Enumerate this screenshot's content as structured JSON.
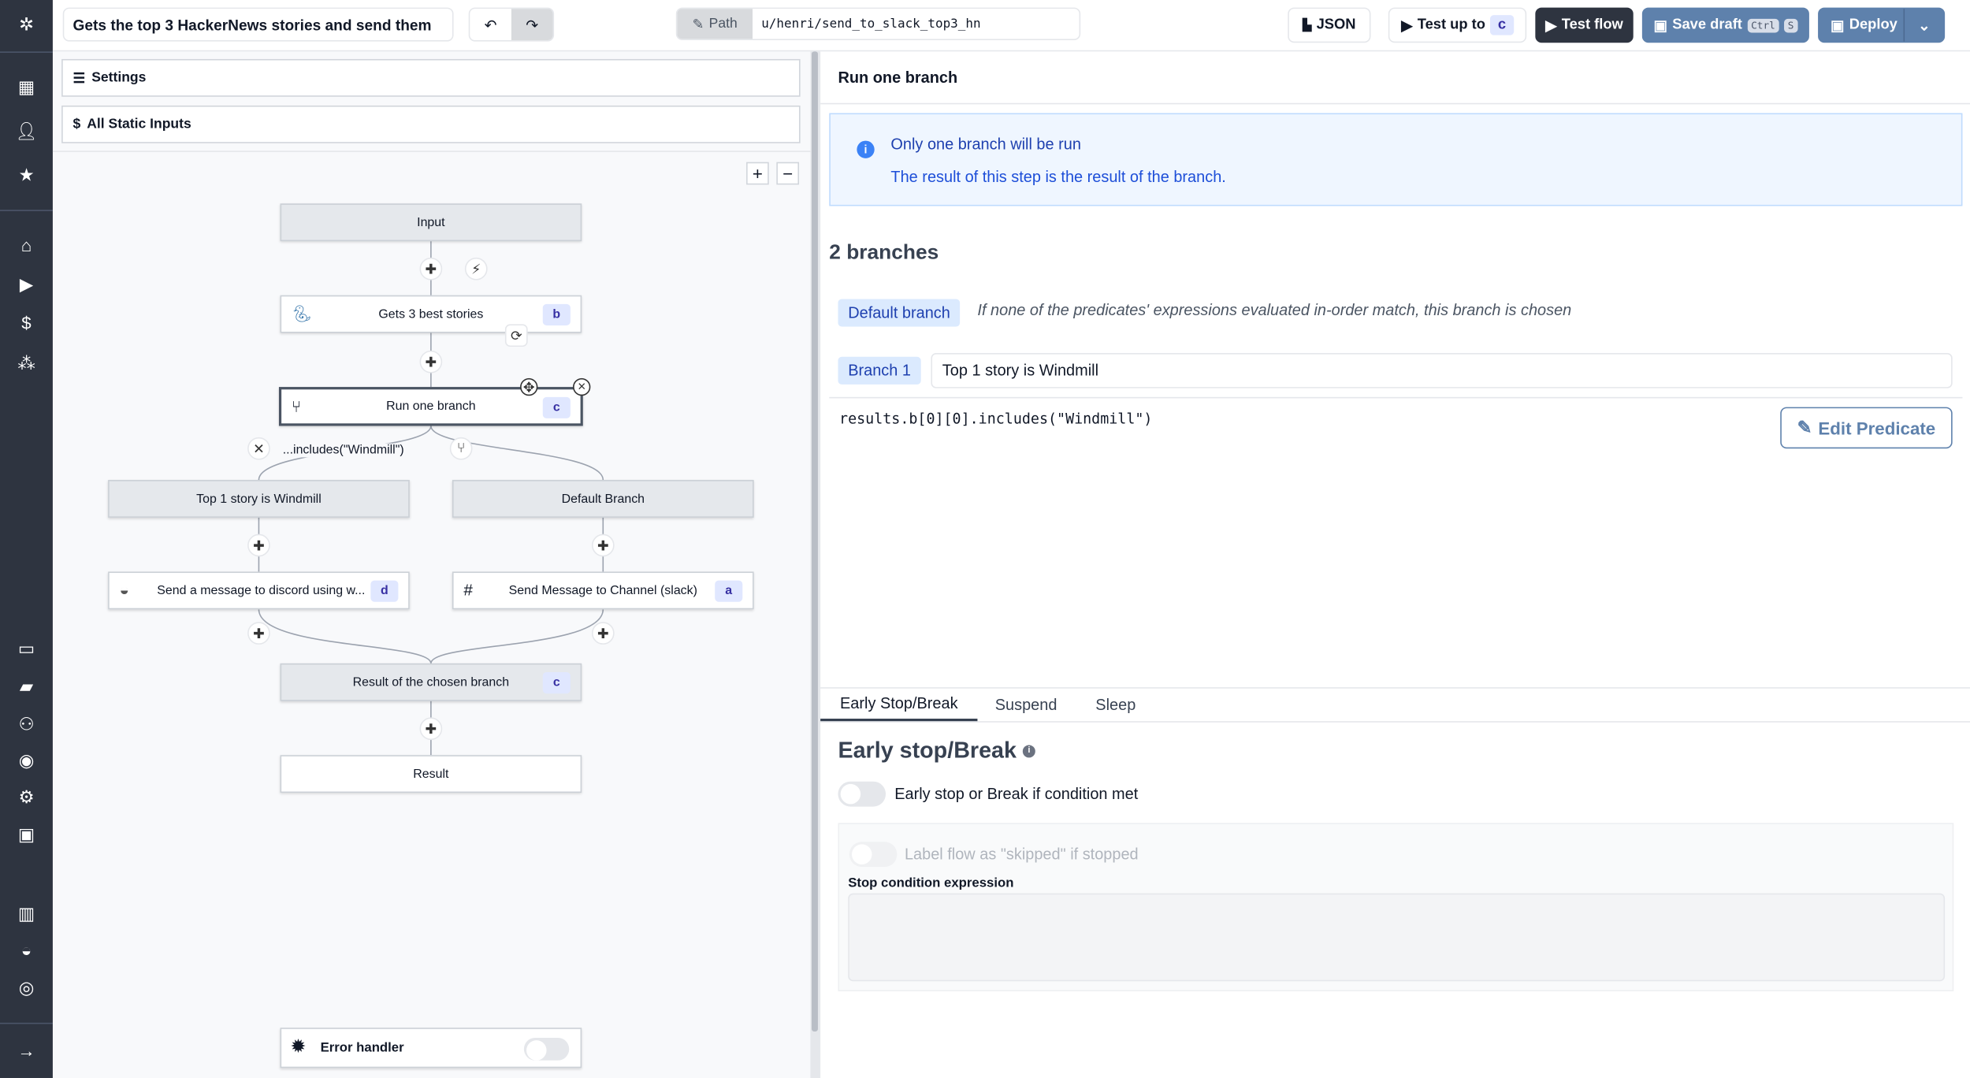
{
  "header": {
    "flow_summary": "Gets the top 3 HackerNews stories and send them",
    "path_label": "Path",
    "path_value": "u/henri/send_to_slack_top3_hn",
    "json_label": "JSON",
    "test_up_to_label": "Test up to",
    "test_up_to_step": "c",
    "test_flow_label": "Test flow",
    "save_draft_label": "Save draft",
    "save_draft_shortcut": [
      "Ctrl",
      "S"
    ],
    "deploy_label": "Deploy"
  },
  "sidebar": {
    "icons": [
      "windmill-logo",
      "building-icon",
      "user-icon",
      "star-icon",
      "home-icon",
      "play-icon",
      "dollar-icon",
      "boxes-icon",
      "calendar-icon",
      "folder-icon",
      "users-cog-icon",
      "eye-icon",
      "gear-icon",
      "bot-icon",
      "book-icon",
      "discord-icon",
      "github-icon",
      "expand-arrow-icon"
    ]
  },
  "left": {
    "settings_label": "Settings",
    "static_inputs_label": "All Static Inputs",
    "zoom_in": "+",
    "zoom_out": "−",
    "nodes": {
      "input": "Input",
      "gets_stories": {
        "label": "Gets 3 best stories",
        "id": "b"
      },
      "run_branch": {
        "label": "Run one branch",
        "id": "c"
      },
      "branch_predicate": "...includes(\"Windmill\")",
      "branch1": "Top 1 story is Windmill",
      "default_branch": "Default Branch",
      "discord": {
        "label": "Send a message to discord using w...",
        "id": "d"
      },
      "slack": {
        "label": "Send Message to Channel (slack)",
        "id": "a"
      },
      "result_branch": {
        "label": "Result of the chosen branch",
        "id": "c"
      },
      "result": "Result"
    },
    "error_handler_label": "Error handler",
    "error_handler_enabled": false
  },
  "right": {
    "title": "Run one branch",
    "info_title": "Only one branch will be run",
    "info_text": "The result of this step is the result of the branch.",
    "branches_count": "2 branches",
    "default_branch_badge": "Default branch",
    "default_branch_desc": "If none of the predicates' expressions evaluated in-order match, this branch is chosen",
    "branch1_badge": "Branch 1",
    "branch1_summary": "Top 1 story is Windmill",
    "branch1_predicate": "results.b[0][0].includes(\"Windmill\")",
    "edit_predicate_label": "Edit Predicate",
    "tabs": [
      "Early Stop/Break",
      "Suspend",
      "Sleep"
    ],
    "active_tab": "Early Stop/Break",
    "early_stop_title": "Early stop/Break",
    "early_stop_toggle_label": "Early stop or Break if condition met",
    "early_stop_enabled": false,
    "skipped_toggle_label": "Label flow as \"skipped\" if stopped",
    "stop_condition_label": "Stop condition expression",
    "stop_condition_value": ""
  },
  "colors": {
    "sidebar": "#2e3440",
    "test_flow": "#2e3440",
    "save_draft": "#5e81ac",
    "info_bg": "#eff6ff",
    "info_text": "#1e40af",
    "badge_bg": "#dbeafe"
  }
}
